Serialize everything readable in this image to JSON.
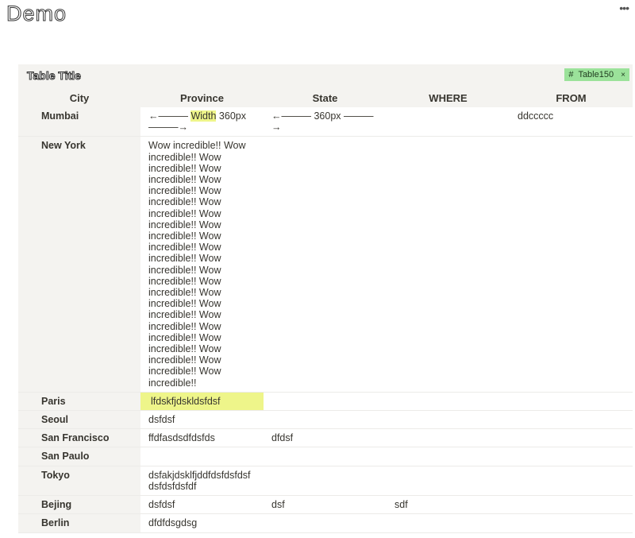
{
  "page": {
    "title": "Demo",
    "more_icon": "more-horizontal-icon"
  },
  "table": {
    "title": "Table Title",
    "tag": {
      "icon": "#",
      "label": "Table150",
      "close": "×",
      "color": "#9be29a"
    },
    "highlight_color": "#eef58a",
    "columns": [
      "City",
      "Province",
      "State",
      "WHERE",
      "FROM"
    ],
    "rows": [
      {
        "city": "Mumbai",
        "cells": [
          "",
          "",
          "",
          "ddccccc"
        ],
        "province_parts": {
          "pre": "←——— ",
          "highlight": "Width",
          "post": " 360px ———→"
        },
        "state": "←——— 360px ———→"
      },
      {
        "city": "New York",
        "cells": [
          "Wow incredible!! Wow incredible!! Wow incredible!! Wow incredible!! Wow incredible!! Wow incredible!! Wow incredible!! Wow incredible!! Wow incredible!! Wow incredible!! Wow incredible!! Wow incredible!! Wow incredible!! Wow incredible!! Wow incredible!! Wow incredible!! Wow incredible!! Wow incredible!! Wow incredible!! Wow incredible!! Wow incredible!! Wow incredible!!",
          "",
          "",
          ""
        ]
      },
      {
        "city": "Paris",
        "cells": [
          "lfdskfjdskldsfdsf",
          "",
          "",
          ""
        ]
      },
      {
        "city": "Seoul",
        "cells": [
          "dsfdsf",
          "",
          "",
          ""
        ]
      },
      {
        "city": "San Francisco",
        "cells": [
          "ffdfasdsdfdsfds",
          "dfdsf",
          "",
          ""
        ]
      },
      {
        "city": "San Paulo",
        "cells": [
          "",
          "",
          "",
          ""
        ]
      },
      {
        "city": "Tokyo",
        "cells": [
          "dsfakjdsklfjddfdsfdsfdsf dsfdsfdsfdf",
          "",
          "",
          ""
        ]
      },
      {
        "city": "Bejing",
        "cells": [
          "dsfdsf",
          "dsf",
          "sdf",
          ""
        ]
      },
      {
        "city": "Berlin",
        "cells": [
          "dfdfdsgdsg",
          "",
          "",
          ""
        ]
      }
    ]
  }
}
